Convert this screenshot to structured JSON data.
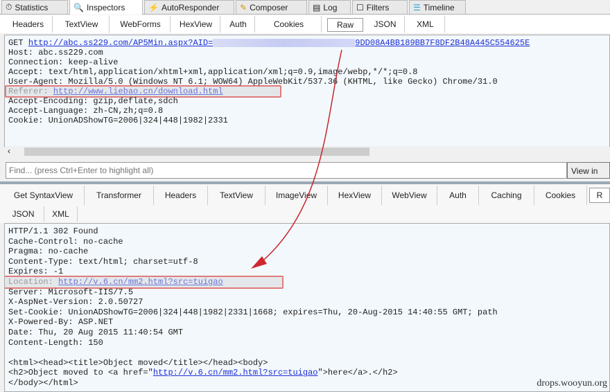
{
  "top_tabs": [
    {
      "label": "Statistics",
      "icon": "stopwatch-icon"
    },
    {
      "label": "Inspectors",
      "icon": "inspector-icon"
    },
    {
      "label": "AutoResponder",
      "icon": "lightning-icon"
    },
    {
      "label": "Composer",
      "icon": "pencil-icon"
    },
    {
      "label": "Log",
      "icon": "log-icon"
    },
    {
      "label": "Filters",
      "icon": "checkbox-icon"
    },
    {
      "label": "Timeline",
      "icon": "timeline-icon"
    }
  ],
  "request_tabs": [
    "Headers",
    "TextView",
    "WebForms",
    "HexView",
    "Auth",
    "Cookies",
    "Raw",
    "JSON",
    "XML"
  ],
  "request": {
    "get_prefix": "GET ",
    "get_url": "http://abc.ss229.com/AP5Min.aspx?AID=",
    "get_url_tail": "9DD08A4BB189BB7F8DF2B48A445C554625E",
    "lines": [
      "Host: abc.ss229.com",
      "Connection: keep-alive",
      "Accept: text/html,application/xhtml+xml,application/xml;q=0.9,image/webp,*/*;q=0.8",
      "User-Agent: Mozilla/5.0 (Windows NT 6.1; WOW64) AppleWebKit/537.36 (KHTML, like Gecko) Chrome/31.0"
    ],
    "referer_label": "Referer: ",
    "referer_url": "http://www.liebao.cn/download.html",
    "lines2": [
      "Accept-Encoding: gzip,deflate,sdch",
      "Accept-Language: zh-CN,zh;q=0.8",
      "Cookie: UnionADShowTG=2006|324|448|1982|2331"
    ]
  },
  "find": {
    "placeholder": "Find... (press Ctrl+Enter to highlight all)",
    "button": "View in"
  },
  "response_tabs": [
    "Get SyntaxView",
    "Transformer",
    "Headers",
    "TextView",
    "ImageView",
    "HexView",
    "WebView",
    "Auth",
    "Caching",
    "Cookies",
    "R"
  ],
  "response_tabs_row2": [
    "JSON",
    "XML"
  ],
  "response": {
    "lines": [
      "HTTP/1.1 302 Found",
      "Cache-Control: no-cache",
      "Pragma: no-cache",
      "Content-Type: text/html; charset=utf-8",
      "Expires: -1"
    ],
    "location_label": "Location: ",
    "location_url": "http://v.6.cn/mm2.html?src=tuigao",
    "lines2": [
      "Server: Microsoft-IIS/7.5",
      "X-AspNet-Version: 2.0.50727",
      "Set-Cookie: UnionADShowTG=2006|324|448|1982|2331|1668; expires=Thu, 20-Aug-2015 14:40:55 GMT; path",
      "X-Powered-By: ASP.NET",
      "Date: Thu, 20 Aug 2015 11:40:54 GMT",
      "Content-Length: 150",
      "",
      "<html><head><title>Object moved</title></head><body>"
    ],
    "h2_prefix": "<h2>Object moved to <a href=\"",
    "h2_url": "http://v.6.cn/mm2.html?src=tuigao",
    "h2_suffix": "\">here</a>.</h2>",
    "last": "</body></html>"
  },
  "watermark": "drops.wooyun.org"
}
